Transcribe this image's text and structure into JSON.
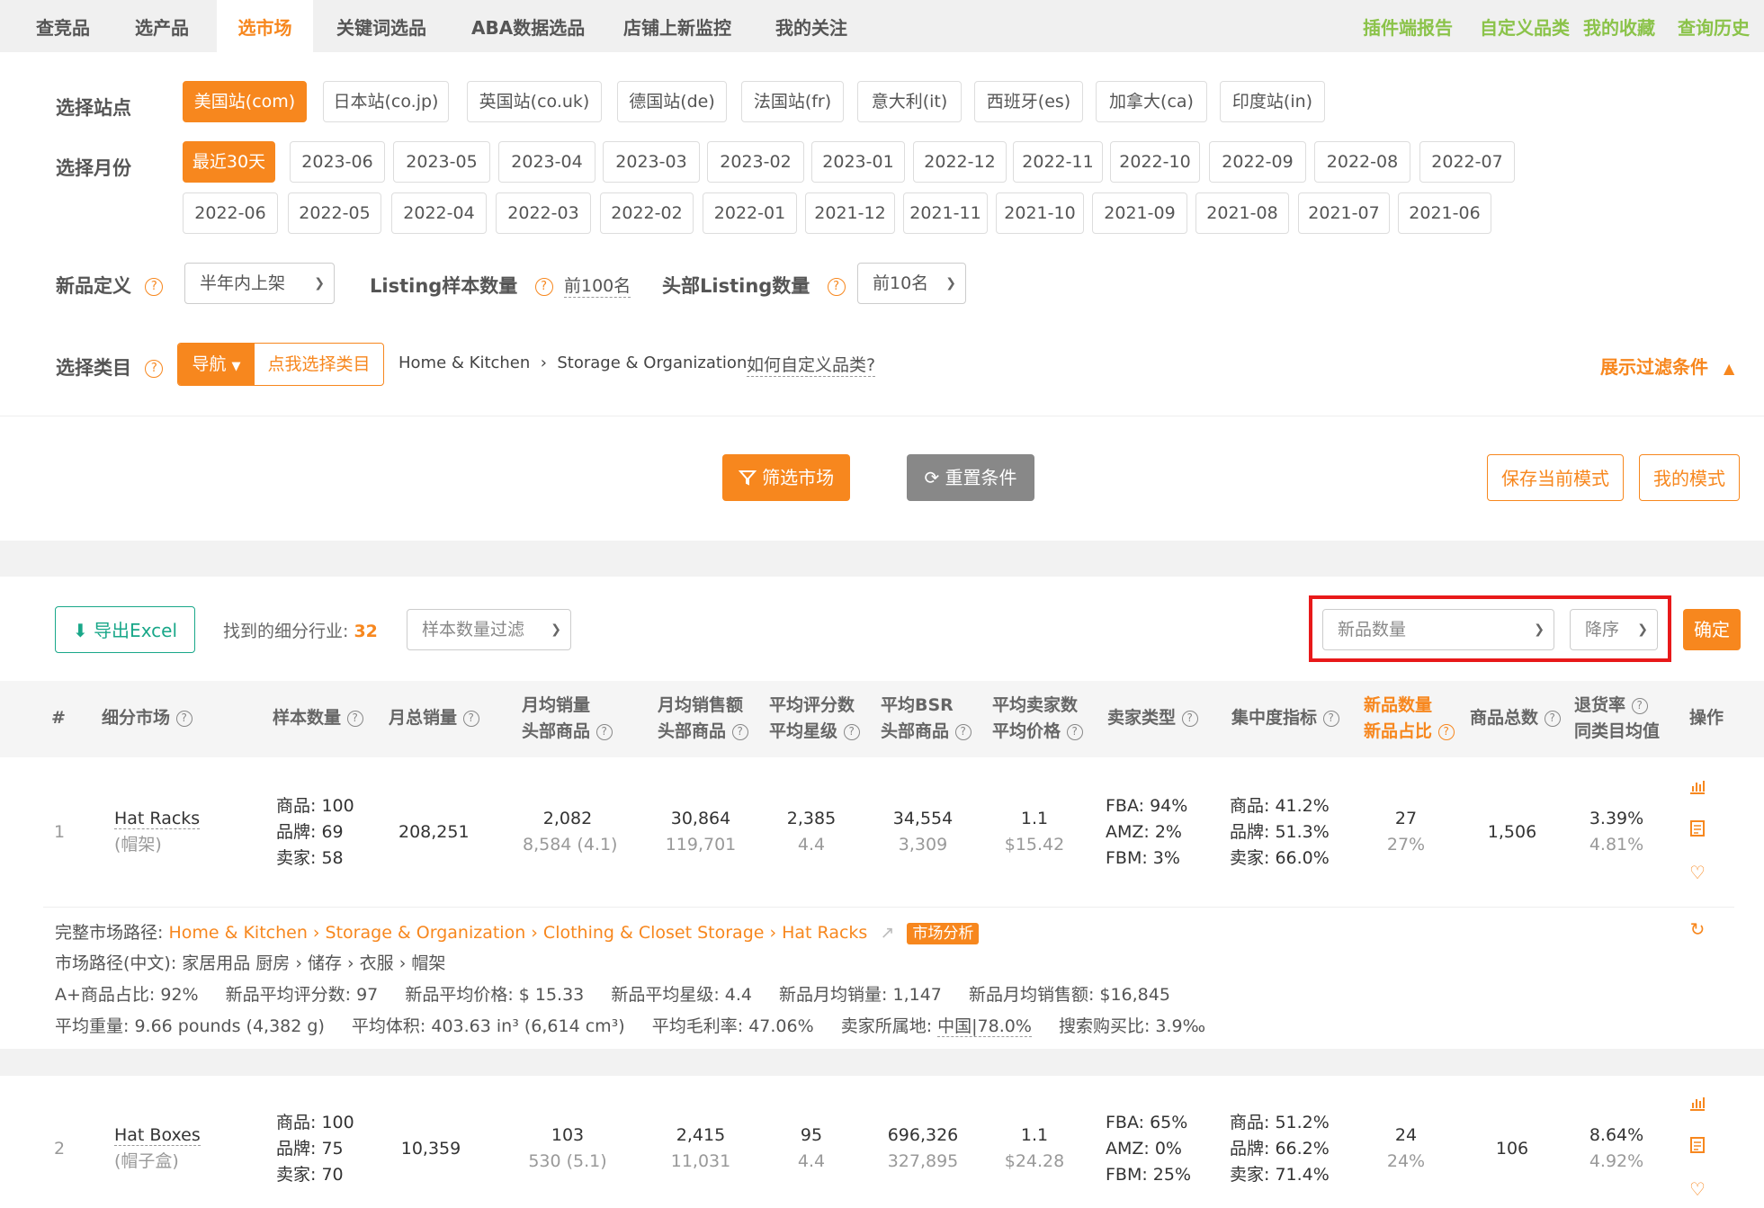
{
  "topnav": {
    "tabs": [
      "查竞品",
      "选产品",
      "选市场",
      "关键词选品",
      "ABA数据选品",
      "店铺上新监控",
      "我的关注"
    ],
    "right_links": [
      "插件端报告",
      "自定义品类",
      "我的收藏",
      "查询历史"
    ]
  },
  "filters": {
    "site_label": "选择站点",
    "sites": [
      "美国站(com)",
      "日本站(co.jp)",
      "英国站(co.uk)",
      "德国站(de)",
      "法国站(fr)",
      "意大利(it)",
      "西班牙(es)",
      "加拿大(ca)",
      "印度站(in)"
    ],
    "month_label": "选择月份",
    "months_row1": [
      "最近30天",
      "2023-06",
      "2023-05",
      "2023-04",
      "2023-03",
      "2023-02",
      "2023-01",
      "2022-12",
      "2022-11",
      "2022-10",
      "2022-09",
      "2022-08",
      "2022-07"
    ],
    "months_row2": [
      "2022-06",
      "2022-05",
      "2022-04",
      "2022-03",
      "2022-02",
      "2022-01",
      "2021-12",
      "2021-11",
      "2021-10",
      "2021-09",
      "2021-08",
      "2021-07",
      "2021-06"
    ],
    "new_def_label": "新品定义",
    "new_def_value": "半年内上架",
    "sample_label": "Listing样本数量",
    "sample_value": "前100名",
    "head_label": "头部Listing数量",
    "head_value": "前10名",
    "category_label": "选择类目",
    "nav_button": "导航",
    "pick_category": "点我选择类目",
    "breadcrumb": "Home & Kitchen  ›  Storage & Organization",
    "how_custom": "如何自定义品类?",
    "show_filters": "展示过滤条件",
    "filter_button": "筛选市场",
    "reset_button": "重置条件",
    "save_mode": "保存当前模式",
    "my_mode": "我的模式"
  },
  "toolbar": {
    "export": "导出Excel",
    "found_label": "找到的细分行业:",
    "found_count": "32",
    "sample_filter": "样本数量过滤",
    "sort_field": "新品数量",
    "sort_order": "降序",
    "confirm": "确定"
  },
  "table": {
    "headers": {
      "idx": "#",
      "market": "细分市场",
      "sample": "样本数量",
      "monthly_sales": "月总销量",
      "avg_sales_1": "月均销量",
      "avg_sales_2": "头部商品",
      "avg_rev_1": "月均销售额",
      "avg_rev_2": "头部商品",
      "rating_1": "平均评分数",
      "rating_2": "平均星级",
      "bsr_1": "平均BSR",
      "bsr_2": "头部商品",
      "seller_1": "平均卖家数",
      "seller_2": "平均价格",
      "seller_type": "卖家类型",
      "concentration": "集中度指标",
      "new_1": "新品数量",
      "new_2": "新品占比",
      "total": "商品总数",
      "return_1": "退货率",
      "return_2": "同类目均值",
      "ops": "操作"
    },
    "rows": [
      {
        "idx": "1",
        "name": "Hat Racks",
        "name_cn": "(帽架)",
        "s1": "商品: 100",
        "s2": "品牌: 69",
        "s3": "卖家: 58",
        "monthly": "208,251",
        "avg_sales": "2,082",
        "avg_sales_sub": "8,584 (4.1)",
        "avg_rev": "30,864",
        "avg_rev_sub": "119,701",
        "rating": "2,385",
        "rating_sub": "4.4",
        "bsr": "34,554",
        "bsr_sub": "3,309",
        "seller": "1.1",
        "price": "$15.42",
        "t1": "FBA: 94%",
        "t2": "AMZ: 2%",
        "t3": "FBM: 3%",
        "c1": "商品: 41.2%",
        "c2": "品牌: 51.3%",
        "c3": "卖家: 66.0%",
        "new": "27",
        "new_pct": "27%",
        "total": "1,506",
        "ret": "3.39%",
        "ret_avg": "4.81%"
      },
      {
        "idx": "2",
        "name": "Hat Boxes",
        "name_cn": "(帽子盒)",
        "s1": "商品: 100",
        "s2": "品牌: 75",
        "s3": "卖家: 70",
        "monthly": "10,359",
        "avg_sales": "103",
        "avg_sales_sub": "530 (5.1)",
        "avg_rev": "2,415",
        "avg_rev_sub": "11,031",
        "rating": "95",
        "rating_sub": "4.4",
        "bsr": "696,326",
        "bsr_sub": "327,895",
        "seller": "1.1",
        "price": "$24.28",
        "t1": "FBA: 65%",
        "t2": "AMZ: 0%",
        "t3": "FBM: 25%",
        "c1": "商品: 51.2%",
        "c2": "品牌: 66.2%",
        "c3": "卖家: 71.4%",
        "new": "24",
        "new_pct": "24%",
        "total": "106",
        "ret": "8.64%",
        "ret_avg": "4.92%"
      }
    ],
    "detail": {
      "path_label": "完整市场路径:",
      "path": "Home & Kitchen › Storage & Organization › Clothing & Closet Storage › Hat Racks",
      "analysis": "市场分析",
      "path_cn": "市场路径(中文): 家居用品 厨房 › 储存 › 衣服 › 帽架",
      "line3": [
        "A+商品占比: 92%",
        "新品平均评分数: 97",
        "新品平均价格: $ 15.33",
        "新品平均星级: 4.4",
        "新品月均销量: 1,147",
        "新品月均销售额: $16,845"
      ],
      "line4_a": "平均重量: 9.66 pounds (4,382 g)",
      "line4_b": "平均体积: 403.63 in³ (6,614 cm³)",
      "line4_c": "平均毛利率: 47.06%",
      "line4_d_label": "卖家所属地: ",
      "line4_d_value": "中国|78.0%",
      "line4_e": "搜索购买比: 3.9‰"
    }
  },
  "icons": [
    "question-icon",
    "chevron-down-icon",
    "filter-icon",
    "refresh-icon",
    "download-icon",
    "chart-icon",
    "document-icon",
    "heart-icon",
    "share-icon",
    "reload-icon",
    "chevron-up-icon"
  ],
  "colors": {
    "accent": "#f7871e",
    "green_link": "#8bc34a",
    "teal": "#19a789",
    "highlight": "#e8191a"
  }
}
